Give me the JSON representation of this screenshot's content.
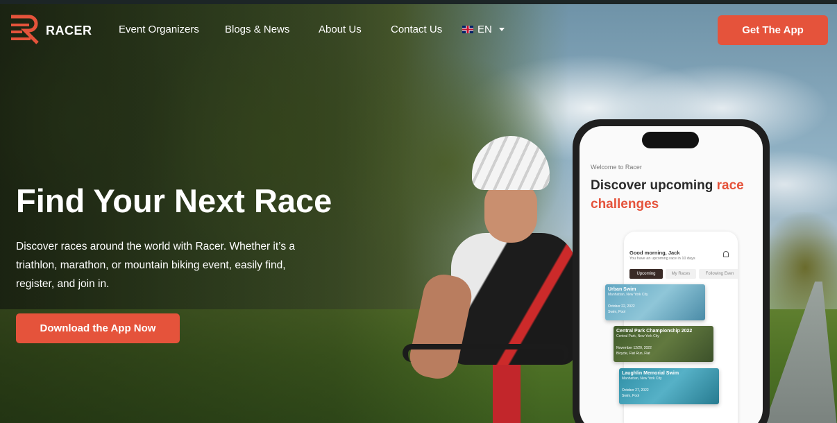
{
  "nav": {
    "brand": "RACER",
    "links": [
      "Event Organizers",
      "Blogs & News",
      "About Us",
      "Contact Us"
    ],
    "language": "EN",
    "cta": "Get The App"
  },
  "hero": {
    "title": "Find Your Next Race",
    "description": "Discover races around the world with Racer. Whether it’s a triathlon, marathon, or mountain biking event, easily find, register, and join in.",
    "button": "Download the App Now"
  },
  "phone": {
    "welcome": "Welcome to Racer",
    "headline_plain": "Discover upcoming",
    "headline_accent": "race challenges",
    "greeting": "Good morning, Jack",
    "greeting_sub": "You have an upcoming race in 10 days",
    "tabs": [
      "Upcoming",
      "My Races",
      "Following Even"
    ],
    "races": [
      {
        "name": "Urban Swim",
        "location": "Manhattan, New York City",
        "date": "October 22, 2022",
        "type": "Swim, Pool"
      },
      {
        "name": "Central Park Championship 2022",
        "location": "Central Park, New York City",
        "date": "November 12/20, 2022",
        "type": "Bicycle, Flat  Run, Flat"
      },
      {
        "name": "Laughlin Memorial Swim",
        "location": "Manhattan, New York City",
        "date": "October 27, 2022",
        "type": "Swim, Pool"
      }
    ]
  },
  "colors": {
    "accent": "#e5533b",
    "text_light": "#ffffff",
    "phone_frame": "#1f1f1f"
  }
}
